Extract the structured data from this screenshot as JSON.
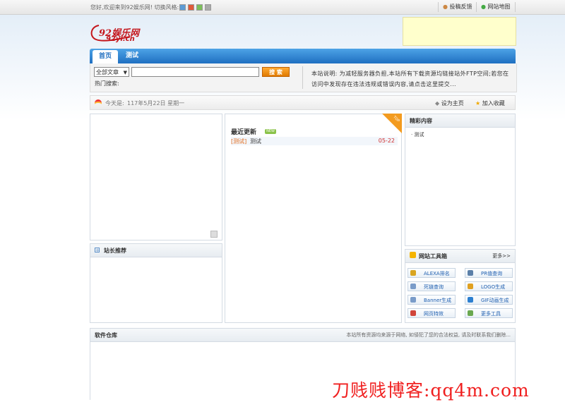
{
  "topbar": {
    "welcome": "您好,欢迎来到92娱乐网! 切换风格:",
    "style_swatches": [
      "#5b9bd5",
      "#e05a3a",
      "#7cbf5a",
      "#aaaaaa"
    ],
    "feedback": "投稿反馈",
    "sitemap": "网站地图"
  },
  "logo": {
    "text": "92娱乐网",
    "sub": "92yl.cn"
  },
  "nav": {
    "home": "首页",
    "test": "测试"
  },
  "search": {
    "category": "全部文章",
    "button": "搜 索",
    "hot_label": "热门搜索:",
    "notice": "本站说明: 为减轻服务器负担,本站所有下载资源均链接站外FTP空间;若您在访问中发现存在违法违规或错误内容,请点击这里提交..."
  },
  "datebar": {
    "today_label": "今天是:",
    "today_value": "117年5月22日 星期一",
    "set_home": "设为主页",
    "bookmark": "加入收藏"
  },
  "recommend": {
    "title": "站长推荐"
  },
  "latest": {
    "title": "最近更新",
    "new_badge": "NEW",
    "corner": "TOP",
    "items": [
      {
        "category": "[测试]",
        "name": "测试",
        "date": "05-22"
      }
    ]
  },
  "featured": {
    "title": "精彩内容",
    "items": [
      "测试"
    ]
  },
  "toolbox": {
    "title": "网站工具箱",
    "more": "更多>>",
    "tools": [
      {
        "label": "ALEXA排名",
        "icon": "person-icon",
        "color": "#d9a521"
      },
      {
        "label": "PR值查询",
        "icon": "pr-icon",
        "color": "#5b7fa8"
      },
      {
        "label": "死链查询",
        "icon": "link-icon",
        "color": "#7a9cc9"
      },
      {
        "label": "LOGO生成",
        "icon": "crown-icon",
        "color": "#e0a020"
      },
      {
        "label": "Banner生成",
        "icon": "tag-icon",
        "color": "#7a9cc9"
      },
      {
        "label": "GIF动画生成",
        "icon": "globe-icon",
        "color": "#2c7fd0"
      },
      {
        "label": "网页特效",
        "icon": "doc-icon",
        "color": "#d0453a"
      },
      {
        "label": "更多工具",
        "icon": "grid-icon",
        "color": "#6aa84f"
      }
    ]
  },
  "storage": {
    "title": "软件仓库",
    "note": "本站所有资源均来源于网络, 如侵犯了您的合法权益, 请及时联系我们删除..."
  },
  "watermark": "刀贱贱博客:qq4m.com"
}
